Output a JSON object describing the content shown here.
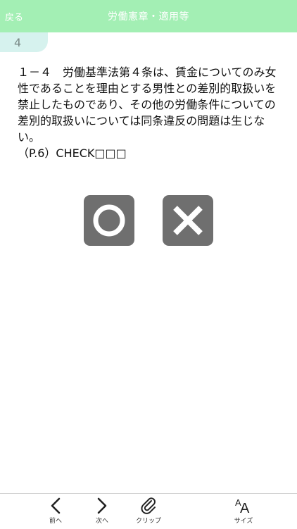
{
  "header": {
    "back_label": "戻る",
    "title": "労働憲章・適用等",
    "background": "#a3efb4"
  },
  "question": {
    "number": "4",
    "lines": [
      "１－４　労働基準法第４条は、賃金についてのみ女",
      "性であることを理由とする男性との差別的取扱いを",
      "禁止したものであり、その他の労働条件についての",
      "差別的取扱いについては同条違反の問題は生じな",
      "い。",
      "（P.6）CHECK□□□"
    ]
  },
  "answers": [
    {
      "name": "maru",
      "icon": "circle-icon"
    },
    {
      "name": "batsu",
      "icon": "cross-icon"
    }
  ],
  "toolbar": {
    "prev_label": "前へ",
    "next_label": "次へ",
    "clip_label": "クリップ",
    "size_label": "サイズ",
    "size_icon_text": "AA"
  }
}
